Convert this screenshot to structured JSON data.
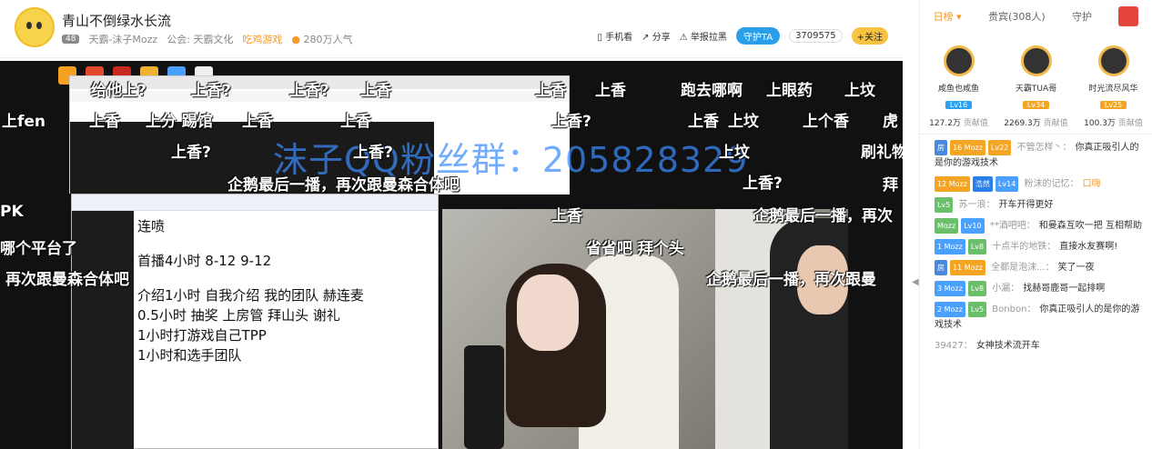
{
  "header": {
    "title": "青山不倒绿水长流",
    "room_level": "48",
    "streamer": "天霸-沫子Mozz",
    "guild": "公会: 天霸文化",
    "game": "吃鸡游戏",
    "popularity": "280万人气",
    "tools": {
      "mobile": "手机看",
      "share": "分享",
      "report": "举报拉黑",
      "guard": "守护TA",
      "fans_count": "3709575",
      "follow": "+关注"
    }
  },
  "video": {
    "watermark": "沫子QQ粉丝群：205828329",
    "notepad_lines": [
      "连喷",
      "",
      "首播4小时 8-12 9-12",
      "",
      "介绍1小时  自我介绍  我的团队  赫连麦",
      "0.5小时  抽奖  上房管  拜山头  谢礼",
      "1小时打游戏自己TPP",
      "1小时和选手团队"
    ],
    "danmaku": [
      "给他上?",
      "上香?",
      "上香?",
      "上香",
      "上香",
      "上香",
      "跑去哪啊",
      "上眼药",
      "上坟",
      "上fen",
      "上香",
      "上分 踢馆",
      "上香",
      "上香",
      "上香?",
      "上香",
      "上坟",
      "上个香",
      "虎",
      "上香?",
      "上香?",
      "上坟",
      "刷礼物",
      "企鹅最后一播，再次跟曼森合体吧",
      "上香?",
      "拜",
      "PK",
      "上香",
      "企鹅最后一播，再次",
      "哪个平台了",
      "省省吧 拜个头",
      "再次跟曼森合体吧",
      "企鹅最后一播，再次跟曼"
    ]
  },
  "right_panel": {
    "tabs": [
      "日榜",
      "贵宾(308人)",
      "守护"
    ],
    "top3": [
      {
        "name": "咸鱼也咸鱼",
        "level": "Lv16",
        "score": "127.2万",
        "unit": "贡献值"
      },
      {
        "name": "天霸TUA哥",
        "level": "Lv34",
        "score": "2269.3万",
        "unit": "贡献值"
      },
      {
        "name": "时光流尽风华",
        "level": "Lv25",
        "score": "100.3万",
        "unit": "贡献值"
      }
    ],
    "messages": [
      {
        "tags": [
          "房",
          "16 Mozz",
          "Lv22"
        ],
        "user": "不管怎样丶：",
        "text": "你真正吸引人的是你的游戏技术"
      },
      {
        "tags": [
          "12 Mozz",
          "浩然",
          "Lv14"
        ],
        "user": "粉沫的记忆：",
        "text": "口嗨"
      },
      {
        "tags": [
          "Lv5"
        ],
        "user": "苏一浪：",
        "text": "开车开得更好"
      },
      {
        "tags": [
          "Mozz",
          "Lv10"
        ],
        "user": "**酒吧吧：",
        "text": "和曼森互吹一把 互相帮助"
      },
      {
        "tags": [
          "1 Mozz",
          "Lv8"
        ],
        "user": "十点半的地铁：",
        "text": "直接水友赛啊!"
      },
      {
        "tags": [
          "房",
          "11 Mozz"
        ],
        "user": "全都是泡沫...：",
        "text": "笑了一夜"
      },
      {
        "tags": [
          "3 Mozz",
          "Lv8"
        ],
        "user": "小漏：",
        "text": "找赫哥鹿哥一起排啊"
      },
      {
        "tags": [
          "2 Mozz",
          "Lv5"
        ],
        "user": "Bonbon：",
        "text": "你真正吸引人的是你的游戏技术"
      },
      {
        "tags": [],
        "user": "39427：",
        "text": "女神技术流开车"
      }
    ]
  }
}
